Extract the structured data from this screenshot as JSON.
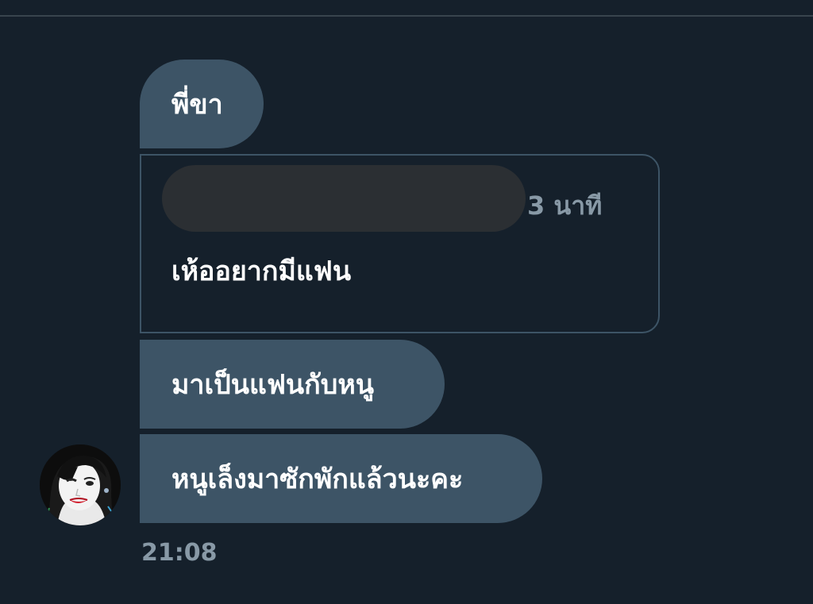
{
  "conversation": {
    "header_fragment": "",
    "messages": [
      {
        "text": "พี่ขา"
      },
      {
        "text": "มาเป็นแฟนกับหนู"
      },
      {
        "text": "หนูเล็งมาซักพักแล้วนะคะ"
      }
    ],
    "quoted_tweet": {
      "author_redacted": true,
      "time_ago": "3 นาที",
      "text": "เห้ออยากมีแฟน"
    },
    "sender_avatar": "avatar-photo",
    "timestamp": "21:08"
  },
  "colors": {
    "background": "#15202b",
    "bubble": "#3d5466",
    "divider": "#38444d",
    "muted_text": "#8899a6",
    "redaction": "#2b2f33"
  }
}
